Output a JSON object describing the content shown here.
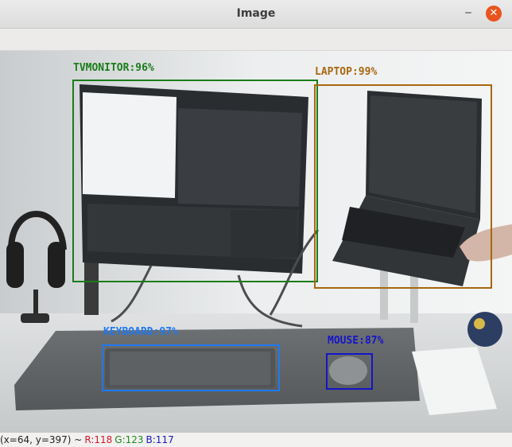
{
  "window": {
    "title": "Image",
    "minimize_glyph": "‒",
    "close_glyph": "✕"
  },
  "detections": [
    {
      "label": "TVMONITOR:96%",
      "color": "#1a7d1a"
    },
    {
      "label": "LAPTOP:99%",
      "color": "#a8670e"
    },
    {
      "label": "KEYBOARD:97%",
      "color": "#1f78f0"
    },
    {
      "label": "MOUSE:87%",
      "color": "#1515c8"
    }
  ],
  "status": {
    "coords": "(x=64, y=397) ~",
    "r": "R:118",
    "g": "G:123",
    "b": "B:117",
    "r_color": "#d4172a",
    "g_color": "#1e8a1e",
    "b_color": "#1717c4"
  }
}
